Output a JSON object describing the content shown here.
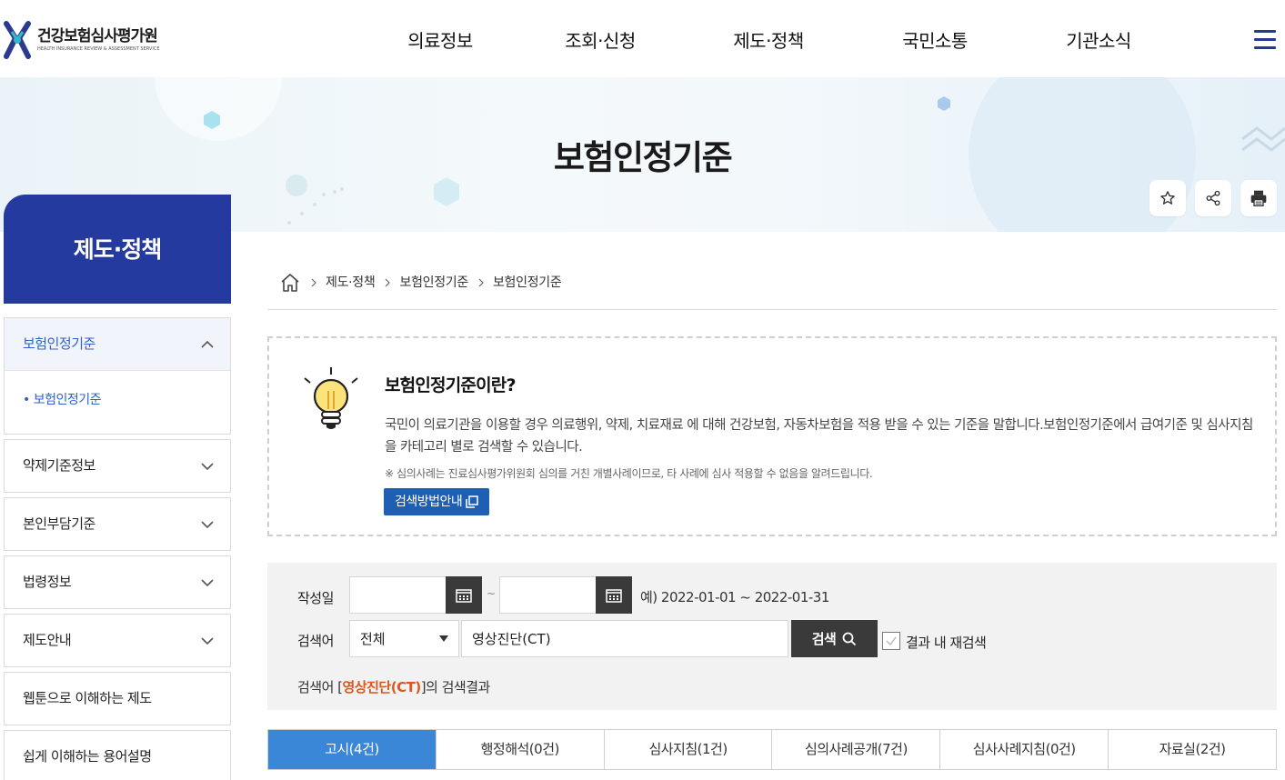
{
  "header": {
    "logo_title": "건강보험심사평가원",
    "logo_subtitle": "HEALTH INSURANCE REVIEW & ASSESSMENT SERVICE",
    "nav": [
      "의료정보",
      "조회·신청",
      "제도·정책",
      "국민소통",
      "기관소식"
    ],
    "menu_icon": "hamburger-icon"
  },
  "banner": {
    "title": "보험인정기준",
    "utils": [
      "star-icon",
      "share-icon",
      "print-icon"
    ]
  },
  "sidebar": {
    "heading": "제도·정책",
    "active_item": "보험인정기준",
    "active_sub": "보험인정기준",
    "items": [
      "약제기준정보",
      "본인부담기준",
      "법령정보",
      "제도안내",
      "웹툰으로 이해하는 제도",
      "쉽게 이해하는 용어설명"
    ]
  },
  "breadcrumb": [
    "제도·정책",
    "보험인정기준",
    "보험인정기준"
  ],
  "info": {
    "title": "보험인정기준이란?",
    "desc": "국민이 의료기관을 이용할 경우 의료행위, 약제, 치료재료 에 대해 건강보험, 자동차보험을 적용 받을 수 있는 기준을 말합니다.보험인정기준에서 급여기준 및 심사지침을 카테고리 별로 검색할 수 있습니다.",
    "note": "※ 심의사례는 진료심사평가위원회 심의를 거친 개별사례이므로, 타 사례에 심사 적용할 수 없음을 알려드립니다.",
    "guide_button": "검색방법안내"
  },
  "search": {
    "date_label": "작성일",
    "date_from": "",
    "date_to": "",
    "tilde": "~",
    "date_example": "예) 2022-01-01 ~ 2022-01-31",
    "keyword_label": "검색어",
    "scope_selected": "전체",
    "keyword_value": "영상진단(CT)",
    "search_button": "검색",
    "research_label": "결과 내 재검색",
    "result_prefix": "검색어 [",
    "result_keyword": "영상진단(CT)",
    "result_suffix": "]의 검색결과"
  },
  "tabs": [
    {
      "label": "고시(4건)",
      "active": true
    },
    {
      "label": "행정해석(0건)",
      "active": false
    },
    {
      "label": "심사지침(1건)",
      "active": false
    },
    {
      "label": "심의사례공개(7건)",
      "active": false
    },
    {
      "label": "심사사례지침(0건)",
      "active": false
    },
    {
      "label": "자료실(2건)",
      "active": false
    }
  ],
  "colors": {
    "brand_blue": "#253a9e",
    "active_tab": "#3a87d8",
    "highlight": "#e0541d",
    "guide_button": "#1e5fb3"
  }
}
